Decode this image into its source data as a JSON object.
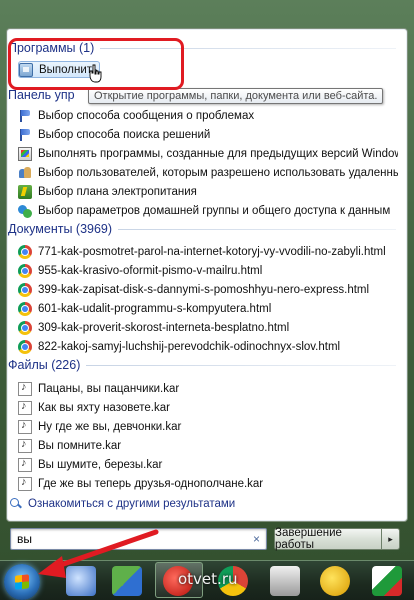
{
  "groups": {
    "programs": {
      "header": "Программы (1)",
      "items": [
        "Выполнить"
      ]
    },
    "control_panel": {
      "header": "Панель упр",
      "items": [
        "Выбор способа сообщения о проблемах",
        "Выбор способа поиска решений",
        "Выполнять программы, созданные для предыдущих версий Windows",
        "Выбор пользователей, которым разрешено использовать удаленный ра...",
        "Выбор плана электропитания",
        "Выбор параметров домашней группы и общего доступа к данным"
      ],
      "icons": [
        "flag-icon",
        "flag-icon",
        "app-compat-icon",
        "users-icon",
        "power-plan-icon",
        "homegroup-icon"
      ]
    },
    "documents": {
      "header": "Документы (3969)",
      "items": [
        "771-kak-posmotret-parol-na-internet-kotoryj-vy-vvodili-no-zabyli.html",
        "955-kak-krasivo-oformit-pismo-v-mailru.html",
        "399-kak-zapisat-disk-s-dannymi-s-pomoshhyu-nero-express.html",
        "601-kak-udalit-programmu-s-kompyutera.html",
        "309-kak-proverit-skorost-interneta-besplatno.html",
        "822-kakoj-samyj-luchshij-perevodchik-odinochnyx-slov.html"
      ]
    },
    "files": {
      "header": "Файлы (226)",
      "items": [
        "Пацаны, вы пацанчики.kar",
        "Как вы яхту назовете.kar",
        "Ну где же вы, девчонки.kar",
        "Вы помните.kar",
        "Вы шумите, березы.kar",
        "Где же вы теперь друзья-однополчане.kar"
      ]
    }
  },
  "tooltip": "Открытие программы, папки, документа или веб-сайта.",
  "more_results": "Ознакомиться с другими результатами",
  "search": {
    "value": "вы",
    "clear_glyph": "×"
  },
  "shutdown": {
    "label": "Завершение работы",
    "arrow": "▸"
  },
  "watermark": "otvet.ru",
  "colors": {
    "annotation": "#e01b22",
    "header_text": "#1e3287"
  }
}
